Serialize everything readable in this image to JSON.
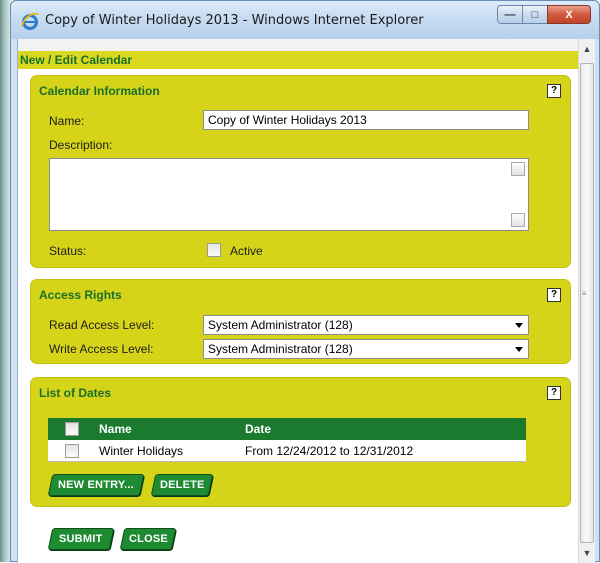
{
  "window": {
    "title": "Copy of Winter Holidays 2013 - Windows Internet Explorer",
    "min_glyph": "—",
    "max_glyph": "□",
    "close_glyph": "X"
  },
  "page": {
    "header": "New / Edit Calendar"
  },
  "calendar_info": {
    "title": "Calendar Information",
    "help": "?",
    "name_label": "Name:",
    "name_value": "Copy of Winter Holidays 2013",
    "description_label": "Description:",
    "description_value": "",
    "status_label": "Status:",
    "active_label": "Active",
    "active_checked": false
  },
  "access_rights": {
    "title": "Access Rights",
    "help": "?",
    "read_label": "Read Access Level:",
    "read_value": "System Administrator (128)",
    "write_label": "Write Access Level:",
    "write_value": "System Administrator (128)"
  },
  "list_of_dates": {
    "title": "List of Dates",
    "help": "?",
    "columns": [
      "Name",
      "Date"
    ],
    "rows": [
      {
        "name": "Winter Holidays",
        "date": "From 12/24/2012 to 12/31/2012",
        "checked": false
      }
    ],
    "new_entry_label": "NEW ENTRY...",
    "delete_label": "DELETE"
  },
  "footer": {
    "submit_label": "SUBMIT",
    "close_label": "CLOSE"
  },
  "colors": {
    "panel": "#d6d419",
    "title_green": "#1a6f2a",
    "button_green": "#1e8a32",
    "table_header": "#1a7a2e"
  }
}
